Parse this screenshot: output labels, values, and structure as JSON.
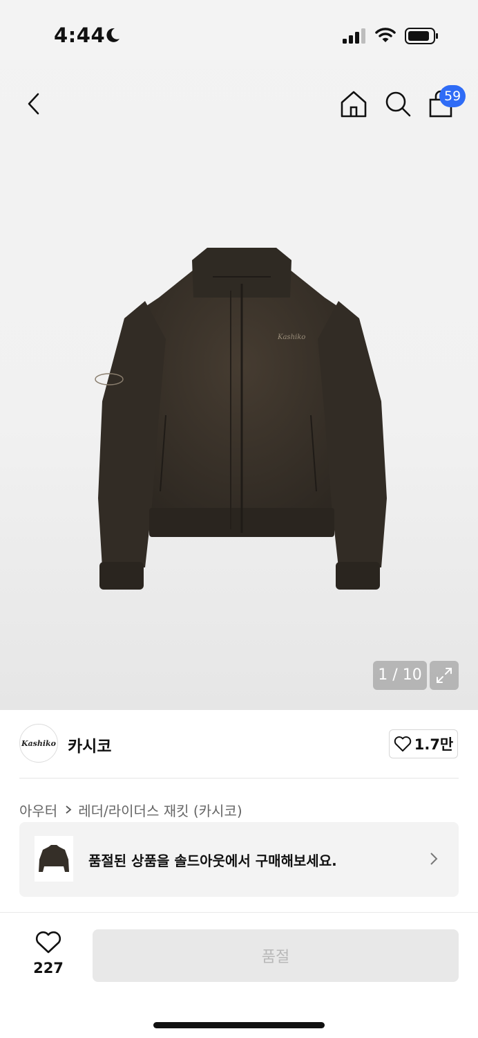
{
  "status_bar": {
    "time": "4:44",
    "icons": [
      "moon-icon",
      "signal-icon",
      "wifi-icon",
      "battery-icon"
    ]
  },
  "nav": {
    "icons": [
      "back-icon",
      "home-icon",
      "search-icon",
      "cart-icon"
    ],
    "cart_badge": "59"
  },
  "gallery": {
    "page_indicator": "1 / 10",
    "expand_icon": "expand-icon",
    "jacket_logo_text": "Kashiko"
  },
  "brand": {
    "logo_text": "Kashiko",
    "name": "카시코",
    "like_count": "1.7만"
  },
  "breadcrumb": {
    "category": "아우터",
    "subcategory": "레더/라이더스 재킷 (카시코)"
  },
  "soldout_banner": {
    "text": "품절된 상품을 솔드아웃에서 구매해보세요."
  },
  "bottom_bar": {
    "wish_count": "227",
    "action_label": "품절"
  },
  "colors": {
    "badge": "#2f6cf6",
    "jacket": "#3a342c",
    "disabled_button": "#e8e8e8",
    "disabled_text": "#b8b8b8"
  }
}
